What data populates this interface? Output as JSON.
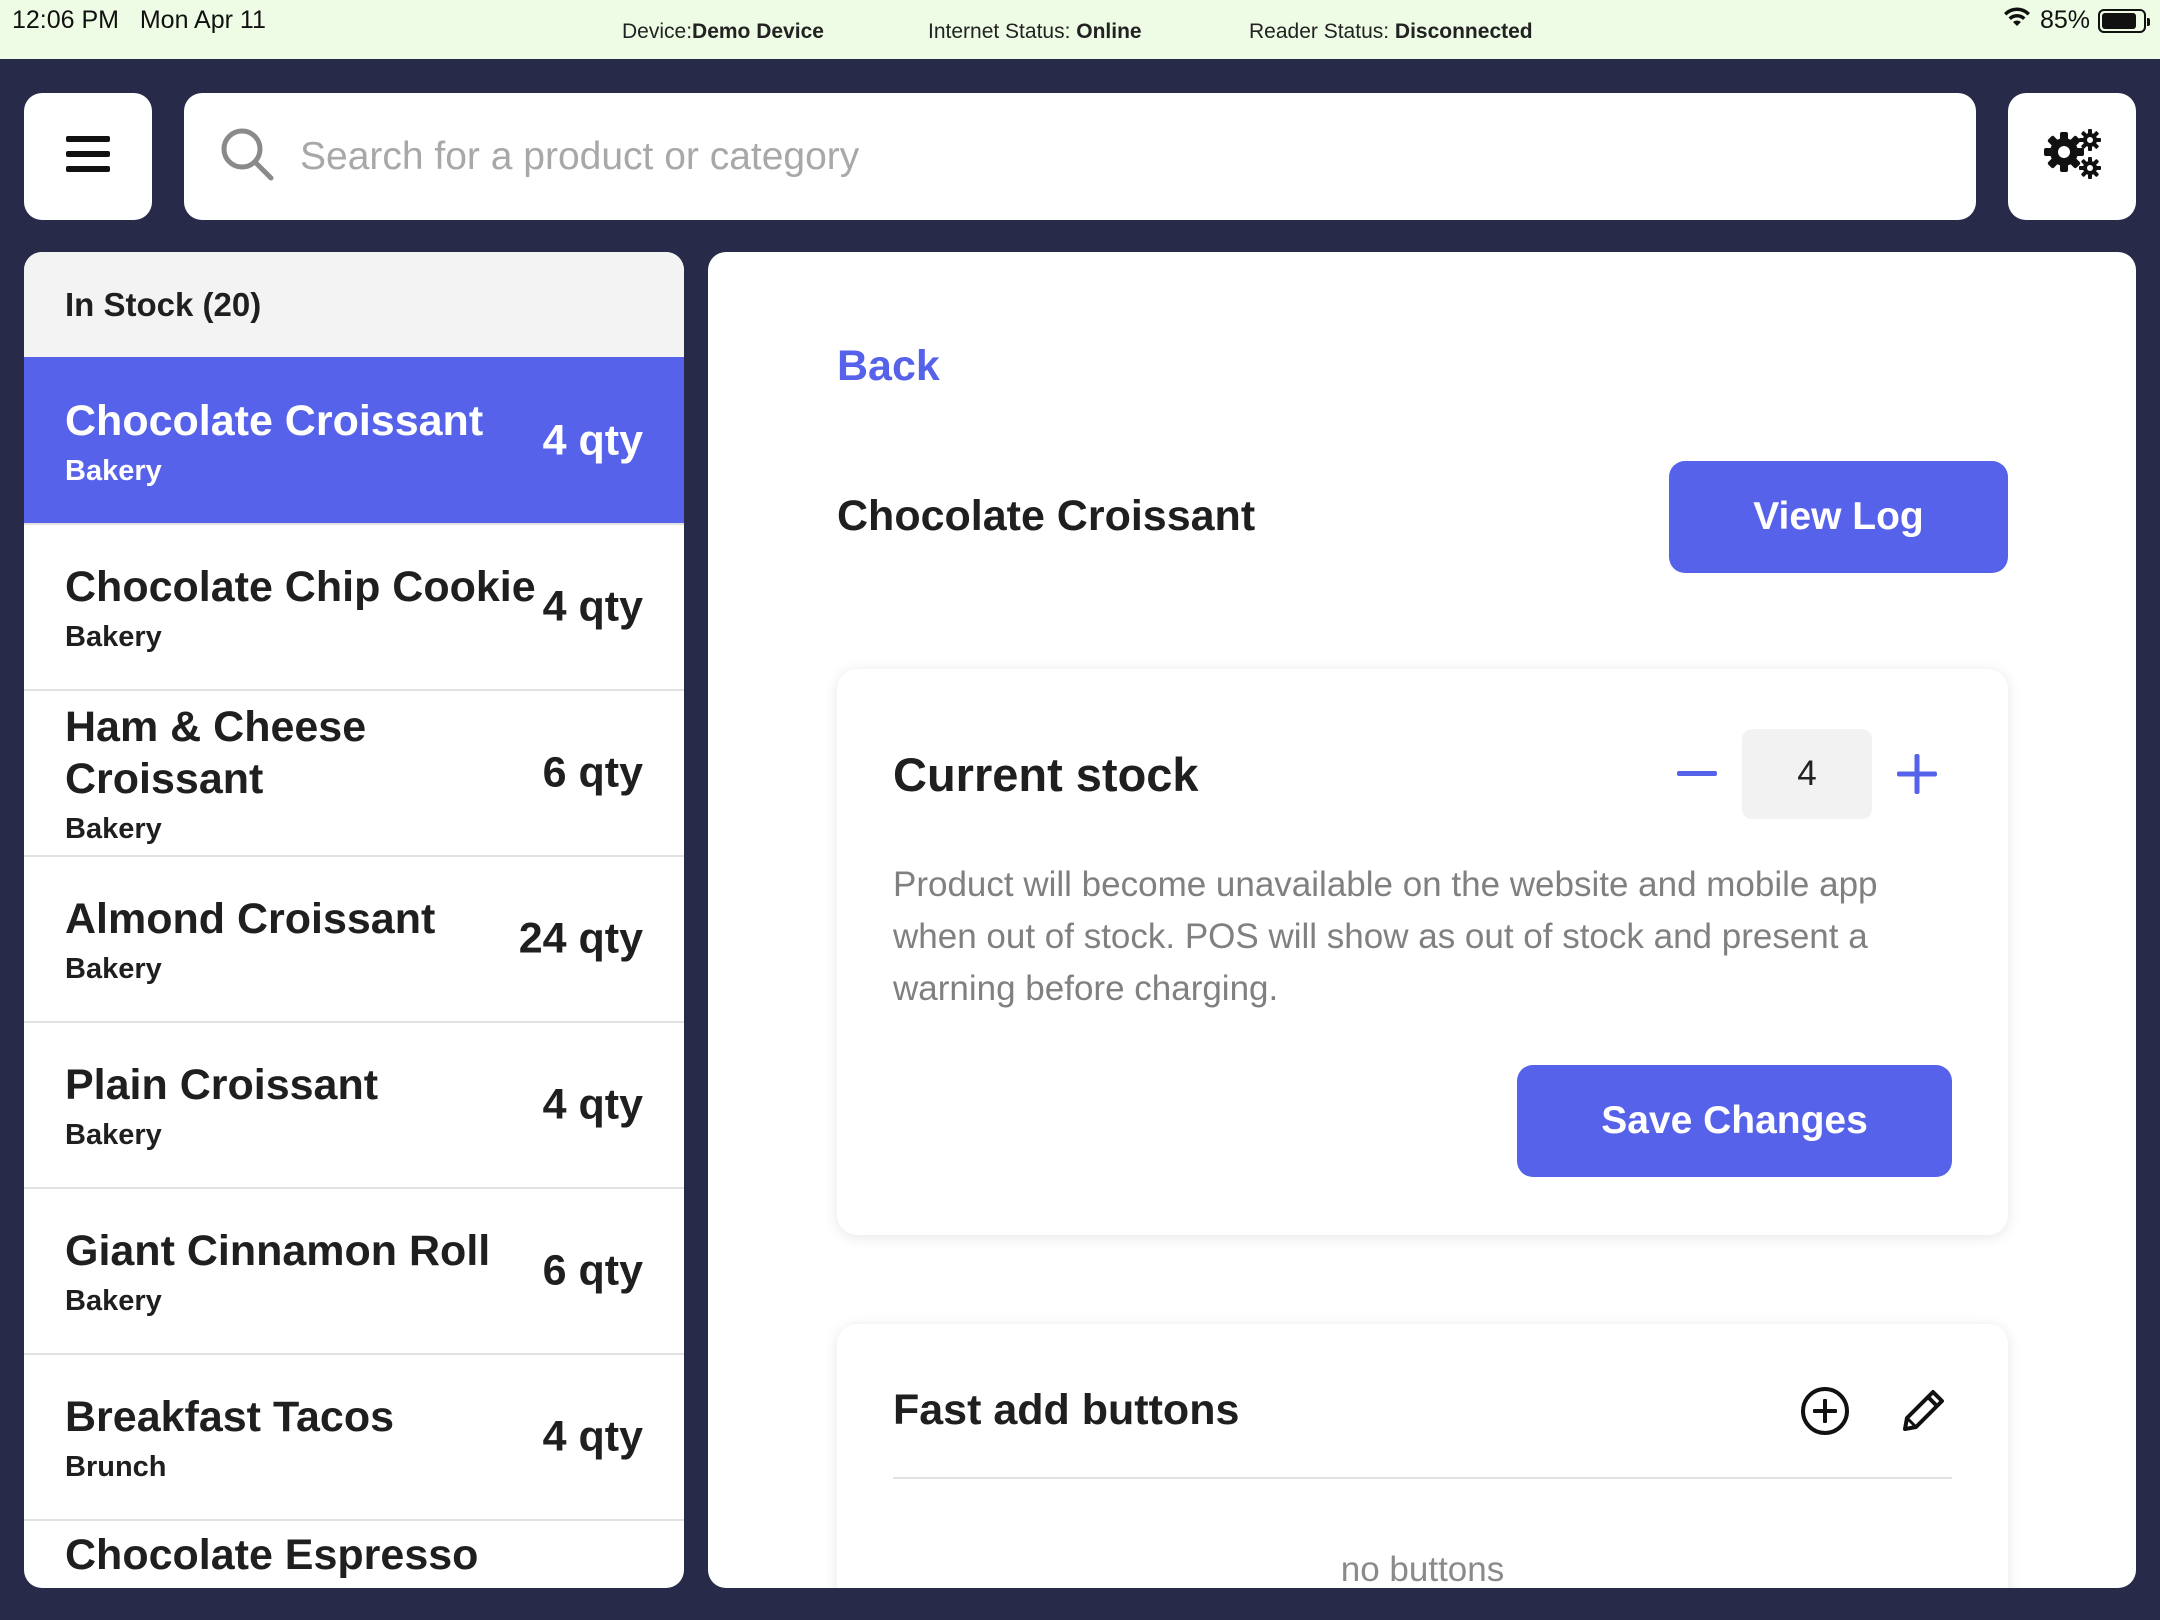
{
  "status_bar": {
    "time": "12:06 PM",
    "date": "Mon Apr 11",
    "device_label": "Device:",
    "device_value": "Demo Device",
    "internet_label": "Internet Status: ",
    "internet_value": "Online",
    "reader_label": "Reader Status: ",
    "reader_value": "Disconnected",
    "battery": "85%",
    "battery_level": 0.85
  },
  "search": {
    "placeholder": "Search for a product or category"
  },
  "icons": {
    "menu": "hamburger-menu-icon",
    "search": "search-icon",
    "settings": "gears-icon",
    "wifi": "wifi-icon",
    "battery": "battery-icon",
    "minus": "minus-icon",
    "plus": "plus-icon",
    "add_circle": "add-circle-icon",
    "pencil": "pencil-icon"
  },
  "colors": {
    "accent": "#5662e9",
    "background": "#272b49",
    "status_bar": "#eefbe5"
  },
  "list": {
    "header": "In Stock (20)",
    "items": [
      {
        "name": "Chocolate Croissant",
        "category": "Bakery",
        "qty": "4 qty"
      },
      {
        "name": "Chocolate Chip Cookie",
        "category": "Bakery",
        "qty": "4 qty"
      },
      {
        "name": "Ham & Cheese Croissant",
        "category": "Bakery",
        "qty": "6 qty"
      },
      {
        "name": "Almond Croissant",
        "category": "Bakery",
        "qty": "24 qty"
      },
      {
        "name": "Plain Croissant",
        "category": "Bakery",
        "qty": "4 qty"
      },
      {
        "name": "Giant Cinnamon Roll",
        "category": "Bakery",
        "qty": "6 qty"
      },
      {
        "name": "Breakfast Tacos",
        "category": "Brunch",
        "qty": "4 qty"
      },
      {
        "name": "Chocolate Espresso",
        "category": "",
        "qty": ""
      }
    ]
  },
  "detail": {
    "back_label": "Back",
    "product_name": "Chocolate Croissant",
    "view_log_label": "View Log",
    "stock": {
      "title": "Current stock",
      "value": "4",
      "description": "Product will become unavailable on the website and mobile app when out of stock. POS will show as out of stock and present a warning before charging.",
      "save_label": "Save Changes"
    },
    "fast_add": {
      "title": "Fast add buttons",
      "empty_text": "no buttons"
    }
  }
}
